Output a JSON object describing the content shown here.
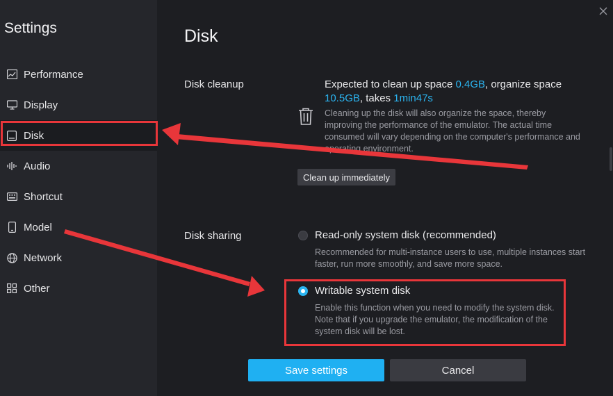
{
  "app": {
    "title": "Settings"
  },
  "sidebar": {
    "items": [
      {
        "label": "Performance",
        "icon": "chart-line-icon"
      },
      {
        "label": "Display",
        "icon": "monitor-icon"
      },
      {
        "label": "Disk",
        "icon": "disk-icon",
        "active": true
      },
      {
        "label": "Audio",
        "icon": "audio-wave-icon"
      },
      {
        "label": "Shortcut",
        "icon": "keyboard-icon"
      },
      {
        "label": "Model",
        "icon": "phone-icon"
      },
      {
        "label": "Network",
        "icon": "globe-icon"
      },
      {
        "label": "Other",
        "icon": "grid-icon"
      }
    ]
  },
  "main": {
    "title": "Disk",
    "cleanup": {
      "label": "Disk cleanup",
      "summary_prefix": "Expected to clean up space ",
      "cleanup_size": "0.4GB",
      "summary_mid": ", organize space ",
      "organize_size": "10.5GB",
      "summary_takes": ", takes ",
      "duration": "1min47s",
      "description": "Cleaning up the disk will also organize the space, thereby improving the performance of the emulator. The actual time consumed will vary depending on the computer's performance and operating environment.",
      "button": "Clean up immediately"
    },
    "sharing": {
      "label": "Disk sharing",
      "options": [
        {
          "title": "Read-only system disk (recommended)",
          "description": "Recommended for multi-instance users to use, multiple instances start faster, run more smoothly, and save more space.",
          "selected": false
        },
        {
          "title": "Writable system disk",
          "description": "Enable this function when you need to modify the system disk. Note that if you upgrade the emulator, the modification of the system disk will be lost.",
          "selected": true
        }
      ]
    }
  },
  "footer": {
    "save": "Save settings",
    "cancel": "Cancel"
  },
  "colors": {
    "accent": "#1fb0f2",
    "highlight": "#2bb4f0",
    "annotation": "#e8363a",
    "sidebar_bg": "#25262b",
    "main_bg": "#1d1e22"
  }
}
